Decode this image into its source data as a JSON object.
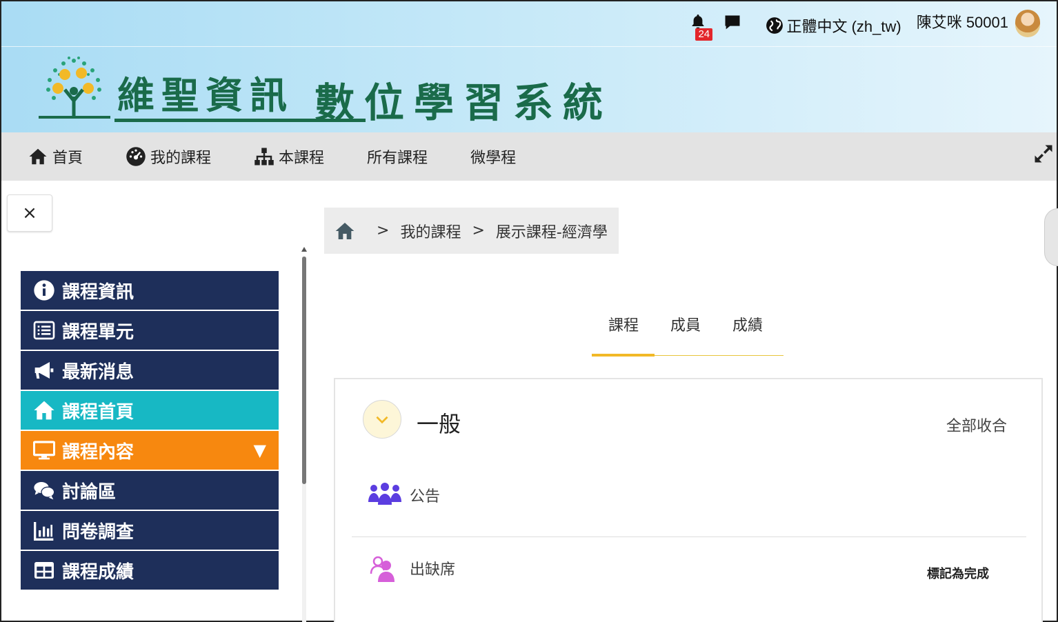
{
  "header": {
    "notification_count": "24",
    "language": "正體中文 (zh_tw)",
    "user_name": "陳艾咪 50001",
    "brand": "維聖資訊",
    "system_title": "數位學習系統"
  },
  "nav": {
    "items": [
      {
        "label": "首頁",
        "icon": "home-icon"
      },
      {
        "label": "我的課程",
        "icon": "dashboard-icon"
      },
      {
        "label": "本課程",
        "icon": "sitemap-icon"
      },
      {
        "label": "所有課程",
        "icon": ""
      },
      {
        "label": "微學程",
        "icon": ""
      }
    ]
  },
  "sidebar": {
    "close_label": "×",
    "items": [
      {
        "label": "課程資訊",
        "icon": "info-icon",
        "state": "normal"
      },
      {
        "label": "課程單元",
        "icon": "list-icon",
        "state": "normal"
      },
      {
        "label": "最新消息",
        "icon": "megaphone-icon",
        "state": "normal"
      },
      {
        "label": "課程首頁",
        "icon": "home-icon",
        "state": "active"
      },
      {
        "label": "課程內容",
        "icon": "monitor-icon",
        "state": "open",
        "caret": "▼"
      },
      {
        "label": "討論區",
        "icon": "comments-icon",
        "state": "normal"
      },
      {
        "label": "問卷調查",
        "icon": "bar-chart-icon",
        "state": "normal"
      },
      {
        "label": "課程成績",
        "icon": "table-icon",
        "state": "normal"
      }
    ]
  },
  "breadcrumb": {
    "items": [
      "我的課程",
      "展示課程-經濟學"
    ],
    "separator": ">"
  },
  "tabs": [
    {
      "label": "課程",
      "active": true
    },
    {
      "label": "成員",
      "active": false
    },
    {
      "label": "成績",
      "active": false
    }
  ],
  "section": {
    "title": "一般",
    "collapse_all": "全部收合",
    "activities": [
      {
        "label": "公告",
        "icon": "group-icon",
        "color": "#5b3de0"
      },
      {
        "label": "出缺席",
        "icon": "attendance-icon",
        "color": "#d65fd9",
        "action": "標記為完成"
      }
    ]
  },
  "colors": {
    "sidebar_bg": "#1e2f5a",
    "sidebar_active": "#17b8c4",
    "sidebar_open": "#f7880f",
    "tab_accent": "#f2b927",
    "brand_green": "#1a6b4a"
  }
}
